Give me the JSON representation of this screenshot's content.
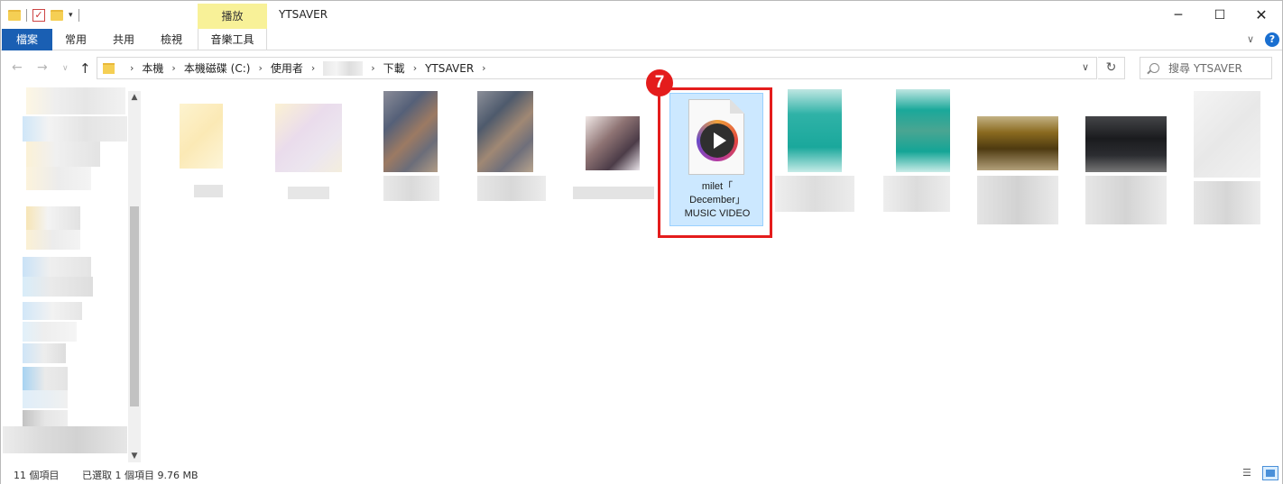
{
  "window": {
    "title": "YTSAVER",
    "context_tab_group": "播放",
    "controls": {
      "minimize": "─",
      "maximize": "☐",
      "close": "✕"
    }
  },
  "ribbon": {
    "tabs": [
      {
        "label": "檔案",
        "active": true
      },
      {
        "label": "常用"
      },
      {
        "label": "共用"
      },
      {
        "label": "檢視"
      },
      {
        "label": "音樂工具"
      }
    ],
    "expand_icon": "chevron-down-icon",
    "help": "?"
  },
  "address": {
    "breadcrumbs": [
      "本機",
      "本機磁碟 (C:)",
      "使用者",
      "",
      "下載",
      "YTSAVER"
    ],
    "separator": "›"
  },
  "search": {
    "placeholder": "搜尋 YTSAVER"
  },
  "files": {
    "selected": {
      "name_lines": [
        "milet「",
        "December」",
        "MUSIC VIDEO"
      ],
      "icon": "play-media-icon"
    }
  },
  "annotation": {
    "step": "7",
    "color": "#e41c1c"
  },
  "status": {
    "item_count": "11 個項目",
    "selection": "已選取 1 個項目  9.76 MB"
  },
  "colors": {
    "accent": "#1a5fb3",
    "selection": "#cce8ff",
    "music_tools_tab": "#f8f198"
  }
}
